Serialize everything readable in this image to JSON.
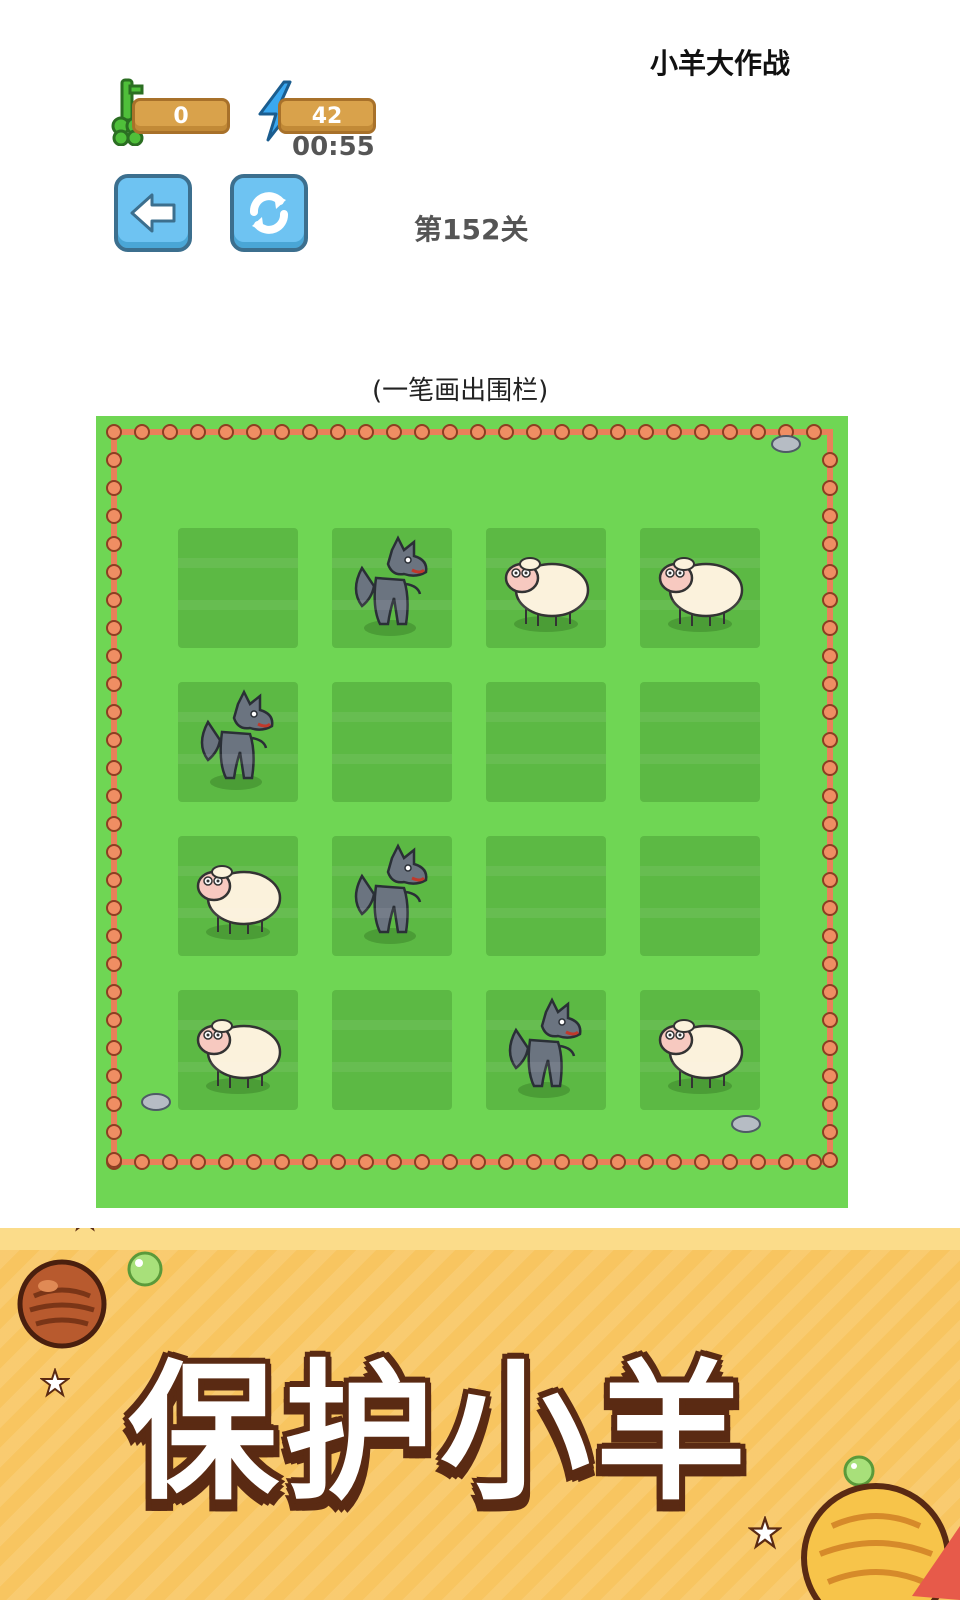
{
  "app_title": "小羊大作战",
  "resources": {
    "keys": "0",
    "energy": "42",
    "timer": "00:55"
  },
  "level": {
    "label": "第152关",
    "hint": "(一笔画出围栏)"
  },
  "board": {
    "rows": 4,
    "cols": 4,
    "cells": [
      [
        "empty",
        "wolf",
        "sheep",
        "sheep"
      ],
      [
        "wolf",
        "empty",
        "empty",
        "empty"
      ],
      [
        "sheep",
        "wolf",
        "empty",
        "empty"
      ],
      [
        "sheep",
        "empty",
        "wolf",
        "sheep"
      ]
    ]
  },
  "banner": {
    "slogan": "保护小羊"
  },
  "colors": {
    "grass": "#6fd654",
    "cell": "#5cb944",
    "fence": "#e8805a",
    "button": "#6ec3f2",
    "banner": "#f8c560"
  },
  "icons": {
    "key": "clover-key-icon",
    "energy": "lightning-icon",
    "back": "back-arrow-icon",
    "refresh": "refresh-icon"
  }
}
